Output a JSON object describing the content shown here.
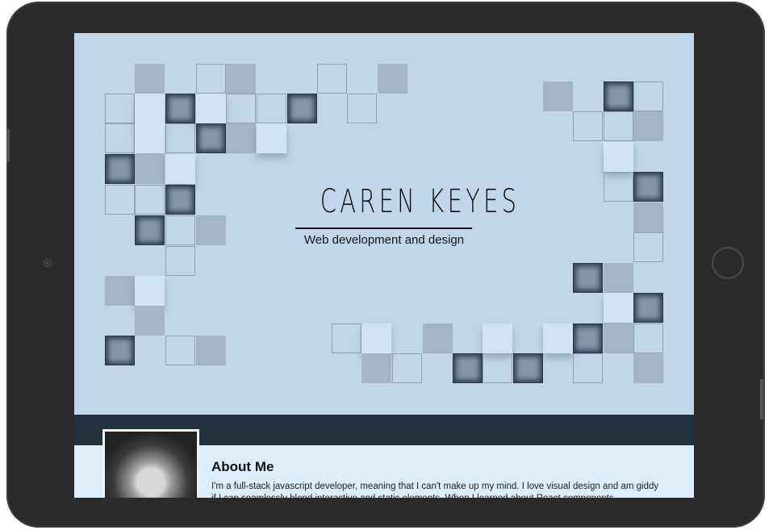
{
  "site": {
    "name": "CAREN KEYES",
    "tagline": "Web development and design"
  },
  "about": {
    "heading": "About Me",
    "text": "I'm a full-stack javascript developer, meaning that I can't make up my mind. I love visual design and am giddy if I can seamlessly blend interactive and static elements. When I learned about React components"
  },
  "colors": {
    "hero_background": "#c0d6eb",
    "navbar": "#233241",
    "about_background": "#dcedfb",
    "device_frame": "#2b2b2b"
  }
}
